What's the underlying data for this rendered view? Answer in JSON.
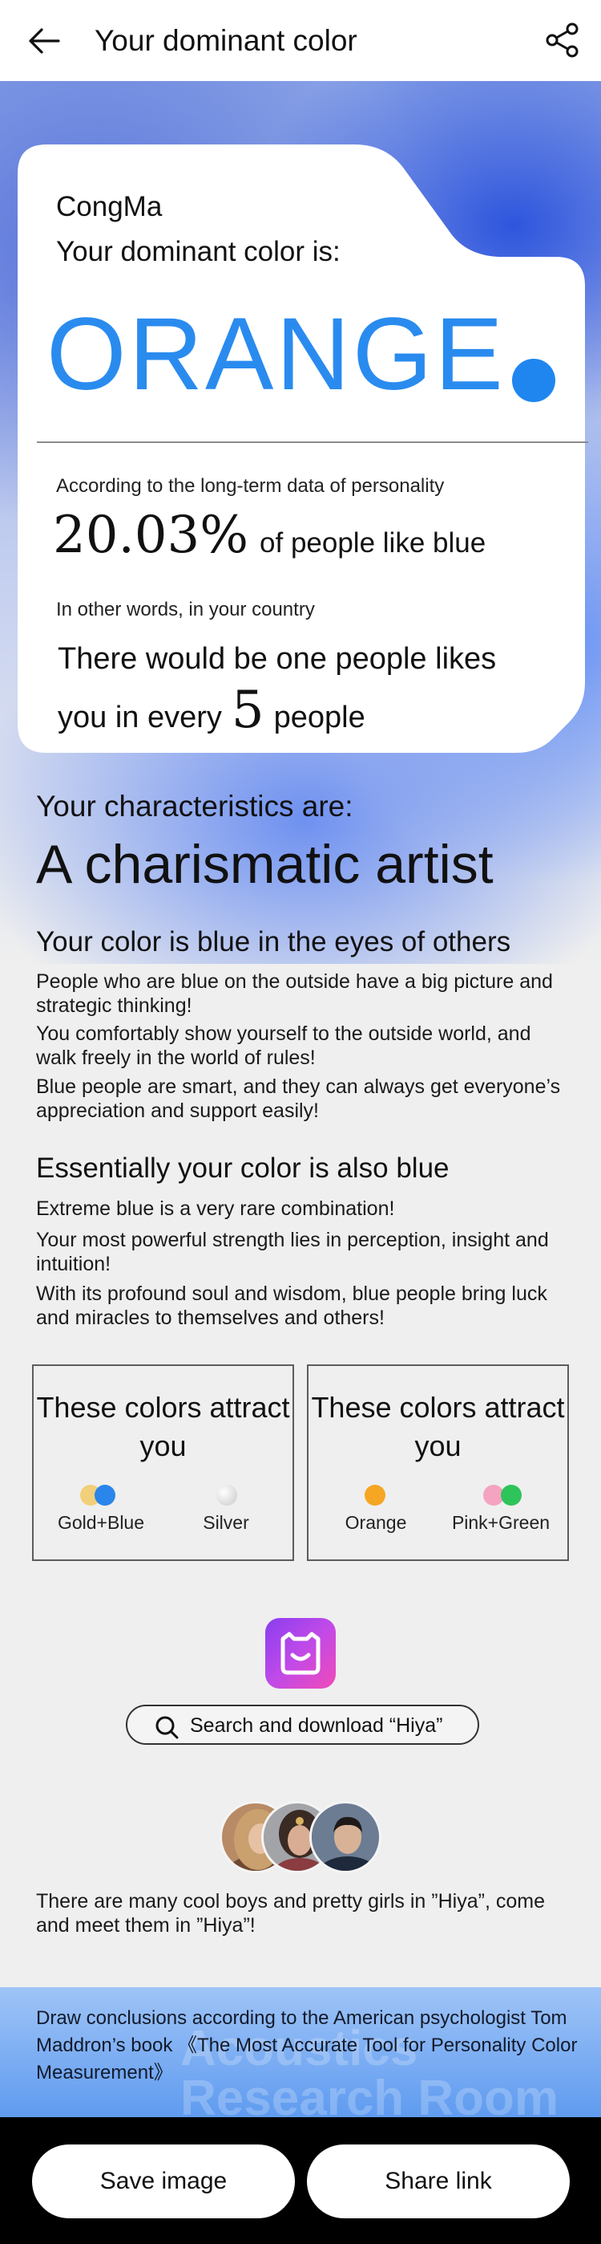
{
  "header": {
    "title": "Your dominant color",
    "back_icon": "arrow-left-icon",
    "share_icon": "share-icon"
  },
  "card": {
    "username": "CongMa",
    "dominant_label": "Your dominant color is:",
    "color_name": "ORANGE",
    "color_dot": "#1f86f0",
    "stat_intro": "According to the long-term data of personality",
    "stat_percent": "20.03%",
    "stat_suffix": "of people like blue",
    "words_intro": "In other words, in your country",
    "ratio_line1": "There would be one people likes",
    "ratio_prefix": "you in every",
    "ratio_number": "5",
    "ratio_suffix": "people"
  },
  "characteristics": {
    "label": "Your characteristics are:",
    "value": "A charismatic artist"
  },
  "outside": {
    "title": "Your color is blue in the eyes of others",
    "paragraphs": [
      "People who are blue on the outside have a big picture and strategic thinking!",
      "You comfortably show yourself to the outside world, and walk freely in the world of rules!",
      "Blue people are smart, and they can always get everyone’s appreciation and support easily!"
    ]
  },
  "essential": {
    "title": "Essentially your color is also blue",
    "paragraphs": [
      "Extreme blue is a very rare combination!",
      "Your most powerful strength lies in perception, insight and intuition!",
      "With its profound soul and wisdom, blue people bring luck and miracles to themselves and others!"
    ]
  },
  "attract": [
    {
      "title": "These colors attract you",
      "left_label": "Gold+Blue",
      "left_colors": [
        "#f2cf7a",
        "#2a86ea"
      ],
      "right_label": "Silver",
      "right_colors": [
        "#d8d8d8"
      ]
    },
    {
      "title": "These colors attract you",
      "left_label": "Orange",
      "left_colors": [
        "#f5a623"
      ],
      "right_label": "Pink+Green",
      "right_colors": [
        "#f4a3c0",
        "#2ec45a"
      ]
    }
  ],
  "app": {
    "logo_icon": "hiya-logo-icon",
    "search_text": "Search and download “Hiya”"
  },
  "invite": {
    "text": "There are many cool boys and pretty girls in ”Hiya”, come and meet them in ”Hiya”!"
  },
  "note": {
    "text": "Draw conclusions according to the American psychologist Tom Maddron’s book 《The Most Accurate Tool for Personality Color Measurement》",
    "watermark_line1": "Acoustics",
    "watermark_line2": "Research Room"
  },
  "actions": {
    "save_label": "Save image",
    "share_label": "Share link"
  }
}
